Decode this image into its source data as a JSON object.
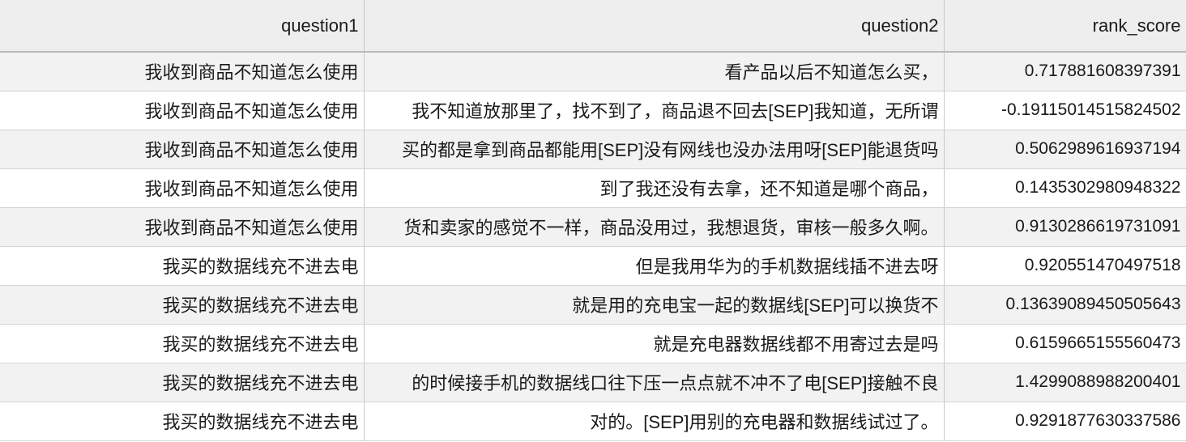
{
  "table": {
    "columns": [
      "question1",
      "question2",
      "rank_score"
    ],
    "rows": [
      [
        "我收到商品不知道怎么使用",
        "看产品以后不知道怎么买，",
        "0.717881608397391"
      ],
      [
        "我收到商品不知道怎么使用",
        "我不知道放那里了，找不到了，商品退不回去[SEP]我知道，无所谓",
        "-0.19115014515824502"
      ],
      [
        "我收到商品不知道怎么使用",
        "买的都是拿到商品都能用[SEP]没有网线也没办法用呀[SEP]能退货吗",
        "0.5062989616937194"
      ],
      [
        "我收到商品不知道怎么使用",
        "到了我还没有去拿，还不知道是哪个商品，",
        "0.1435302980948322"
      ],
      [
        "我收到商品不知道怎么使用",
        "货和卖家的感觉不一样，商品没用过，我想退货，审核一般多久啊。",
        "0.9130286619731091"
      ],
      [
        "我买的数据线充不进去电",
        "但是我用华为的手机数据线插不进去呀",
        "0.920551470497518"
      ],
      [
        "我买的数据线充不进去电",
        "就是用的充电宝一起的数据线[SEP]可以换货不",
        "0.13639089450505643"
      ],
      [
        "我买的数据线充不进去电",
        "就是充电器数据线都不用寄过去是吗",
        "0.6159665155560473"
      ],
      [
        "我买的数据线充不进去电",
        "的时候接手机的数据线口往下压一点点就不冲不了电[SEP]接触不良",
        "1.4299088988200401"
      ],
      [
        "我买的数据线充不进去电",
        "对的。[SEP]用别的充电器和数据线试过了。",
        "0.9291877630337586"
      ]
    ]
  }
}
